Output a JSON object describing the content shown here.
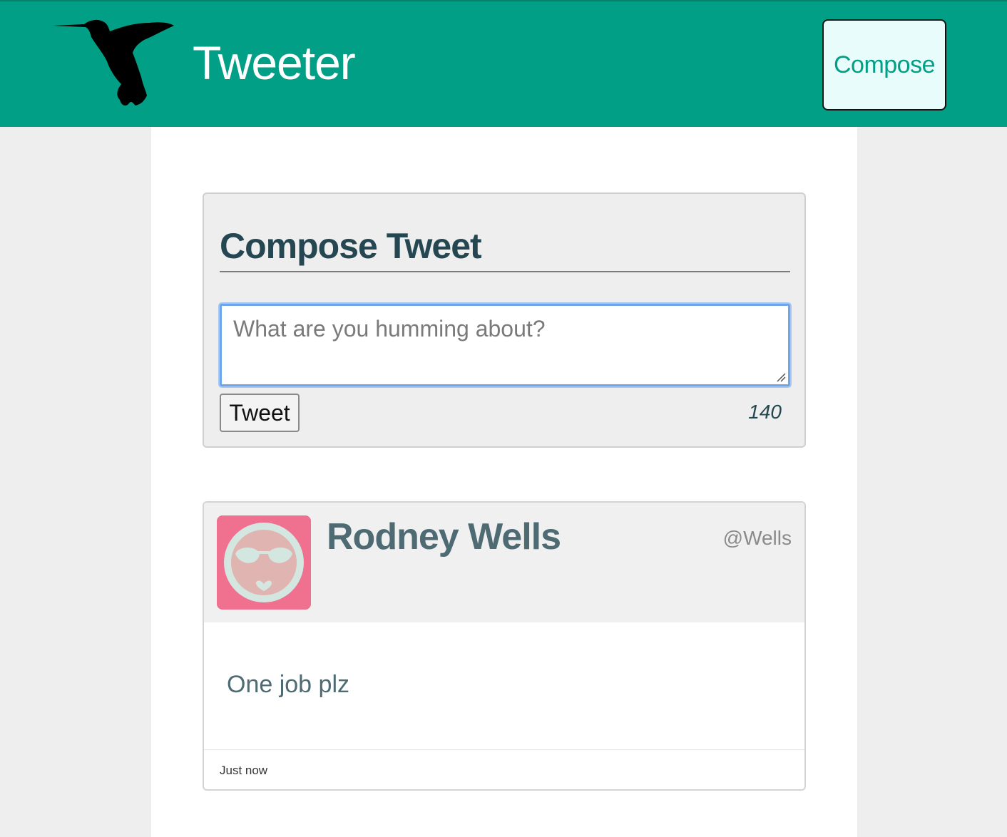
{
  "header": {
    "brand": "Tweeter",
    "compose_label": "Compose",
    "logo_icon": "hummingbird-icon",
    "background_color": "#009f86"
  },
  "new_tweet": {
    "title": "Compose Tweet",
    "placeholder": "What are you humming about?",
    "value": "",
    "submit_label": "Tweet",
    "counter": "140"
  },
  "tweet": {
    "name": "Rodney Wells",
    "handle": "@Wells",
    "avatar_icon": "sunglasses-face-avatar",
    "body": "One job plz",
    "timestamp": "Just now"
  }
}
